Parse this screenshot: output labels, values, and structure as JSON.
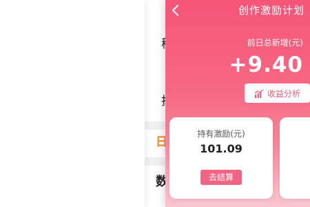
{
  "background_page": {
    "chars": [
      "秘",
      "抖",
      "日",
      "数"
    ]
  },
  "panel": {
    "title": "创作激励计划",
    "metric": {
      "label": "前日总新增(元)",
      "value": "+9.40"
    },
    "analysis_button": {
      "label": "收益分析",
      "icon": "bar-chart-icon"
    },
    "back_icon": "chevron-left-icon"
  },
  "cards": [
    {
      "label": "持有激励(元)",
      "value": "101.09",
      "button_label": "去结算"
    }
  ],
  "colors": {
    "panel_top": "#f55578",
    "panel_bottom": "#f9c6cf",
    "accent": "#f16484",
    "accent_text": "#e95b78",
    "orange": "#f08a24"
  }
}
